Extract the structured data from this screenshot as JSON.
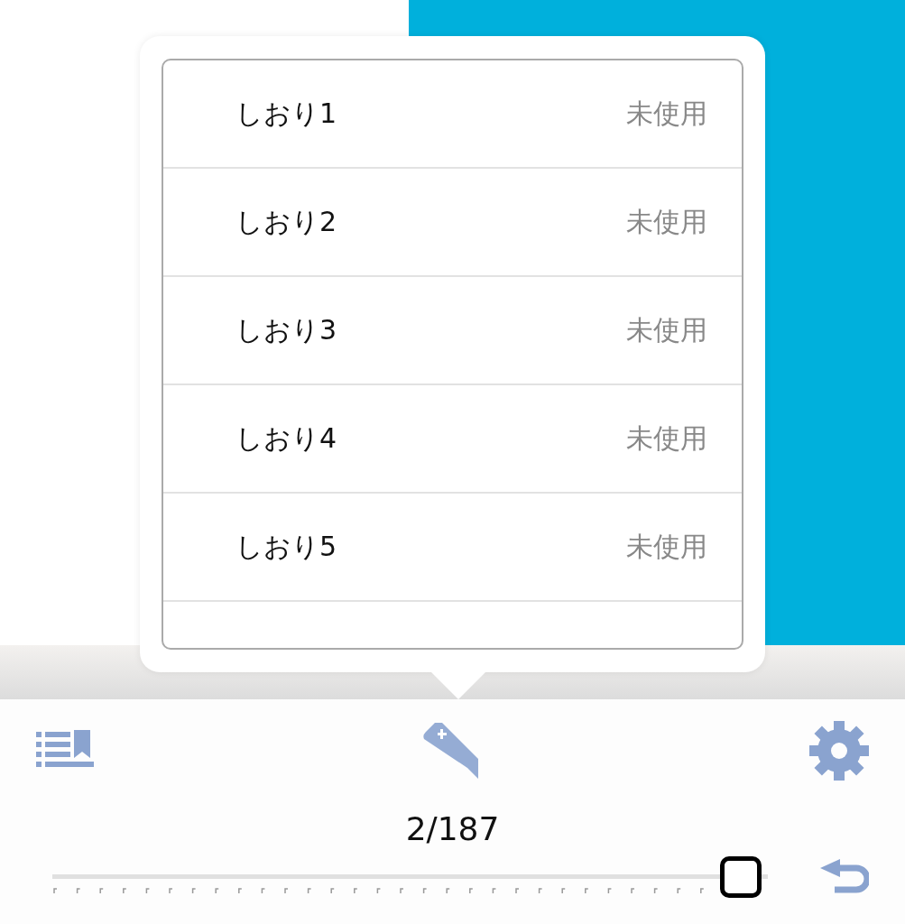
{
  "bookmarks_popup": {
    "items": [
      {
        "label": "しおり1",
        "status": "未使用"
      },
      {
        "label": "しおり2",
        "status": "未使用"
      },
      {
        "label": "しおり3",
        "status": "未使用"
      },
      {
        "label": "しおり4",
        "status": "未使用"
      },
      {
        "label": "しおり5",
        "status": "未使用"
      }
    ]
  },
  "toolbar": {
    "page_indicator": "2/187",
    "slider": {
      "level": 0.99
    }
  }
}
